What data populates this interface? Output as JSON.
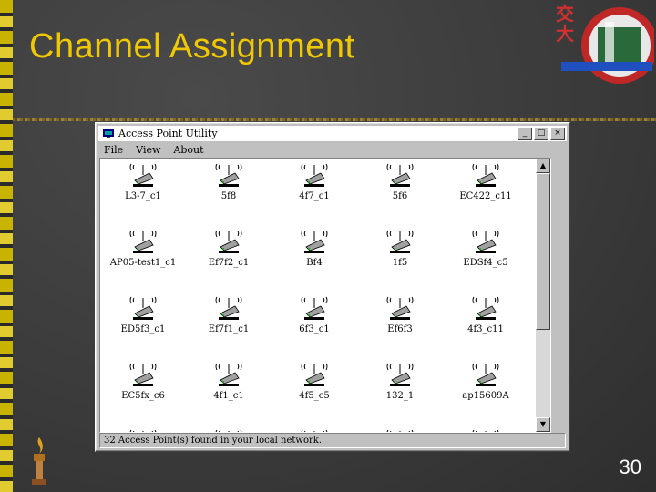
{
  "slide": {
    "title": "Channel Assignment",
    "page_number": "30",
    "logo_chars": [
      "交",
      "大"
    ],
    "colors": {
      "title": "#f0c800",
      "background": "#3a3a3a"
    }
  },
  "window": {
    "title": "Access Point Utility",
    "buttons": {
      "minimize": "_",
      "maximize": "□",
      "close": "×"
    },
    "menu": [
      {
        "label": "File"
      },
      {
        "label": "View"
      },
      {
        "label": "About"
      }
    ],
    "access_points": [
      "L3-7_c1",
      "5f8",
      "4f7_c1",
      "5f6",
      "EC422_c11",
      "AP05-test1_c1",
      "Ef7f2_c1",
      "Bf4",
      "1f5",
      "EDSf4_c5",
      "ED5f3_c1",
      "Ef7f1_c1",
      "6f3_c1",
      "Ef6f3",
      "4f3_c11",
      "EC5fx_c6",
      "4f1_c1",
      "4f5_c5",
      "132_1",
      "ap15609A",
      "",
      "",
      "",
      "",
      ""
    ],
    "status": "32 Access Point(s) found in your local network.",
    "icons": {
      "app": "app-icon",
      "access_point": "wireless-access-point-icon"
    }
  }
}
